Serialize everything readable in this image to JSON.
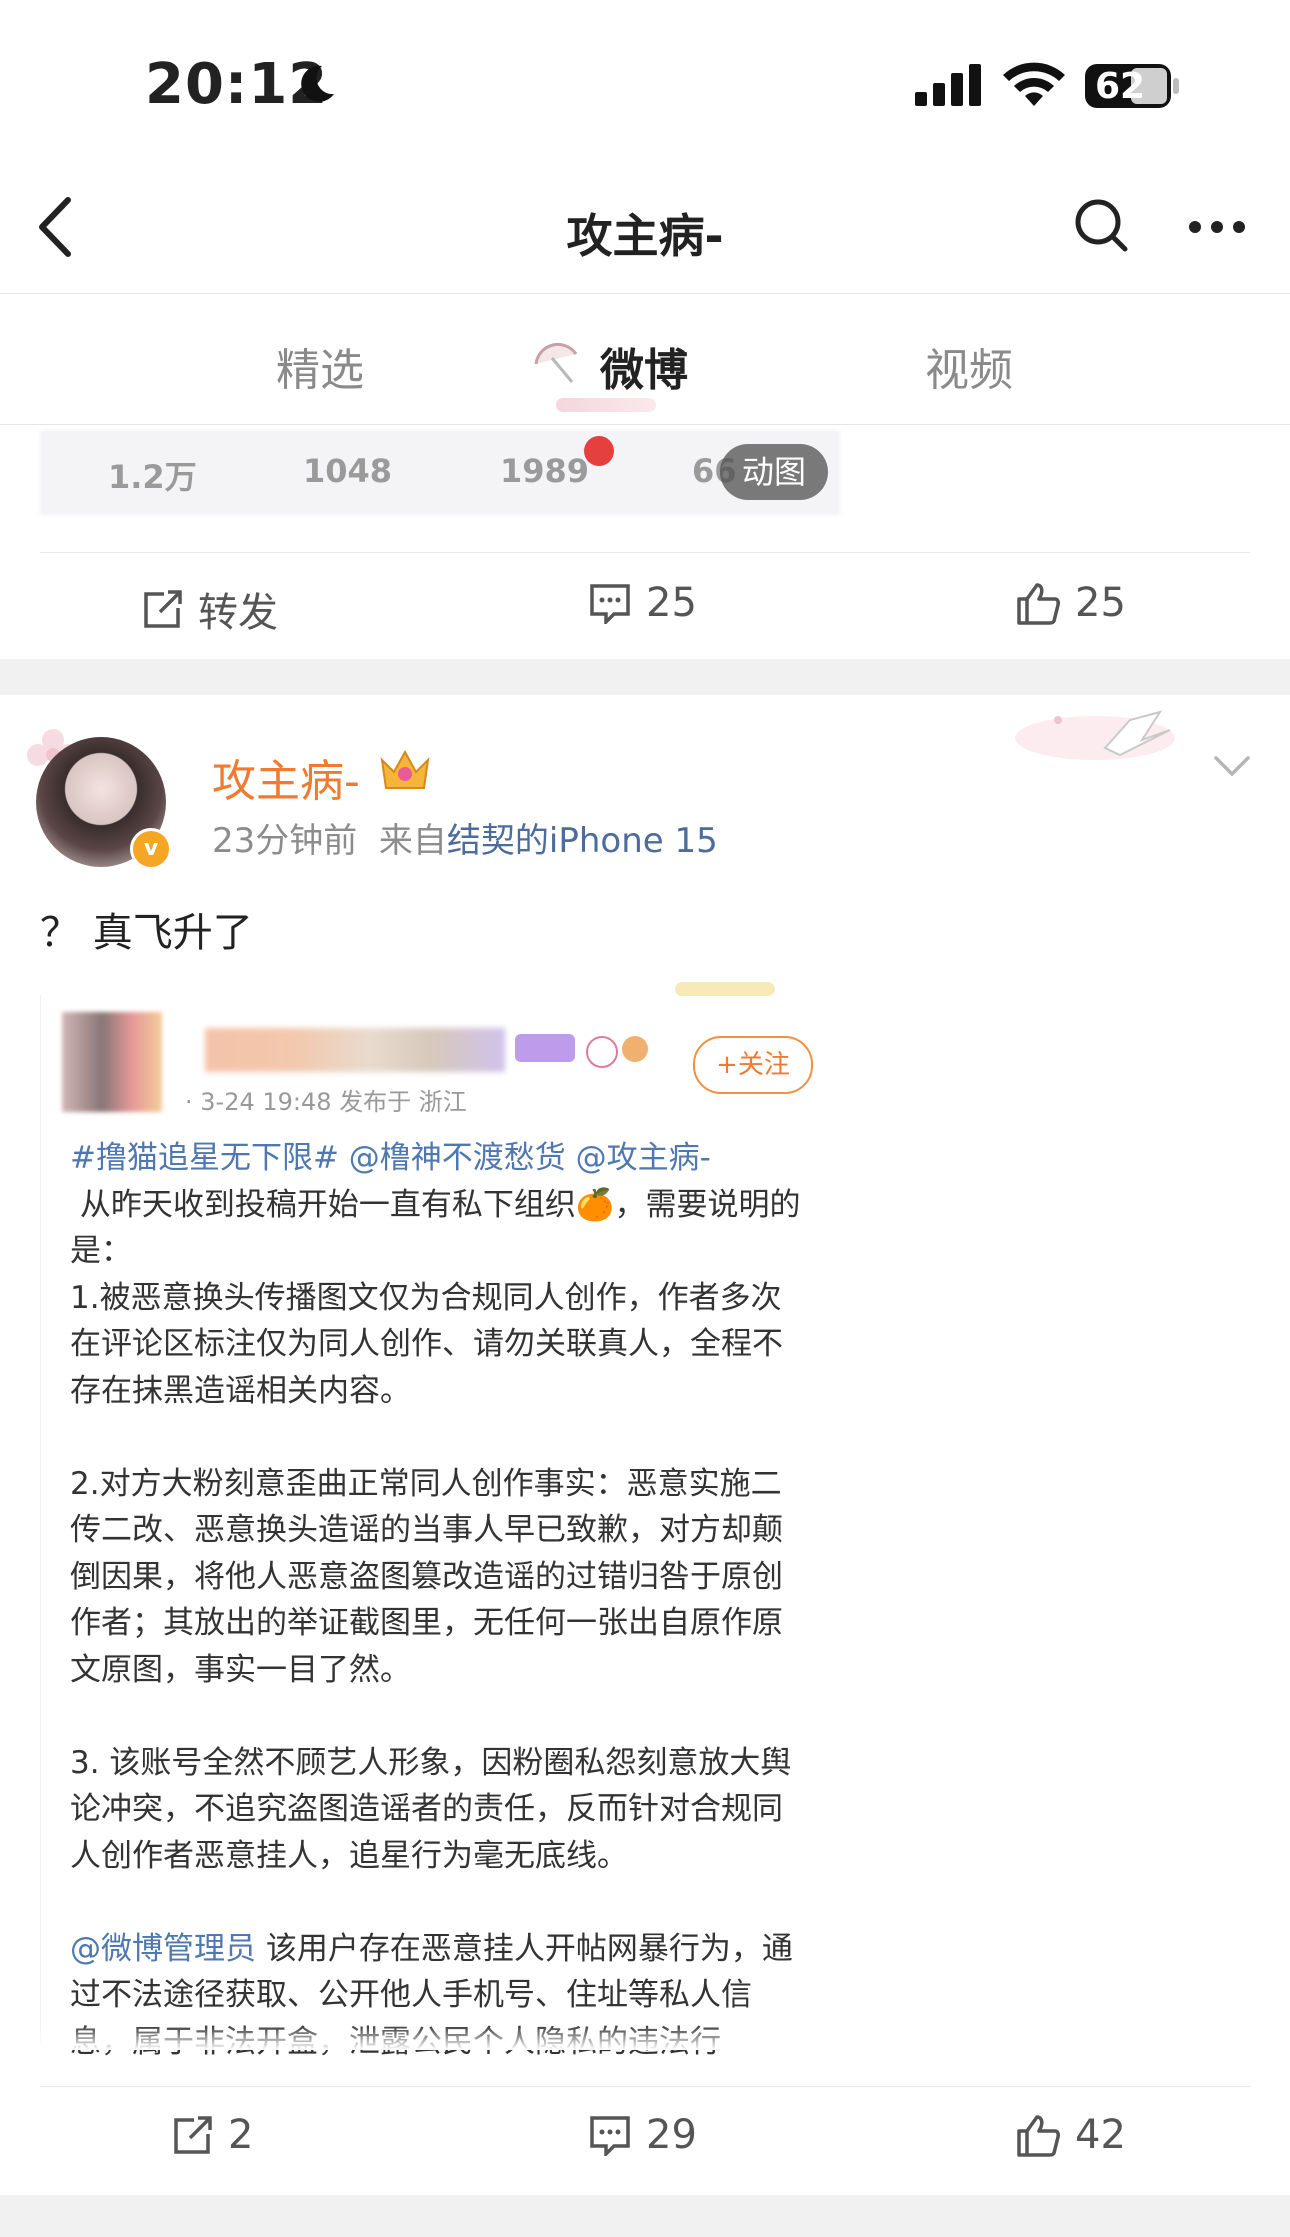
{
  "status_bar": {
    "time": "20:12",
    "battery": "62"
  },
  "nav": {
    "title": "攻主病-"
  },
  "tabs": [
    {
      "label": "精选"
    },
    {
      "label": "微博"
    },
    {
      "label": "视频"
    }
  ],
  "prev_post": {
    "stats": [
      "1.2万",
      "1048",
      "1989",
      "66"
    ],
    "gif_badge": "动图",
    "actions": {
      "repost": "转发",
      "comments": "25",
      "likes": "25"
    }
  },
  "post": {
    "author": "攻主病-",
    "time": "23分钟前",
    "source_prefix": "来自",
    "source": "结契的iPhone 15",
    "text": "？ 真飞升了",
    "quoted_screenshot": {
      "follow_label": "+关注",
      "meta": "· 3-24 19:48  发布于 浙江",
      "lines": [
        {
          "tag": "#撸猫追星无下限# @橹神不渡愁货 @攻主病-",
          "text": ""
        },
        {
          "tag": "",
          "text": " 从昨天收到投稿开始一直有私下组织🍊，需要说明的是："
        },
        {
          "tag": "",
          "text": "1.被恶意换头传播图文仅为合规同人创作，作者多次在评论区标注仅为同人创作、请勿关联真人，全程不存在抹黑造谣相关内容。"
        },
        {
          "tag": "",
          "text": " "
        },
        {
          "tag": "",
          "text": "2.对方大粉刻意歪曲正常同人创作事实：恶意实施二传二改、恶意换头造谣的当事人早已致歉，对方却颠倒因果，将他人恶意盗图篡改造谣的过错归咎于原创作者；其放出的举证截图里，无任何一张出自原作原文原图，事实一目了然。"
        },
        {
          "tag": "",
          "text": " "
        },
        {
          "tag": "",
          "text": "3. 该账号全然不顾艺人形象，因粉圈私怨刻意放大舆论冲突，不追究盗图造谣者的责任，反而针对合规同人创作者恶意挂人，追星行为毫无底线。"
        },
        {
          "tag": "",
          "text": " "
        },
        {
          "tag": "@微博管理员",
          "text": " 该用户存在恶意挂人开帖网暴行为，通过不法途径获取、公开他人手机号、住址等私人信息，属于非法开盒，泄露公民个人隐私的违法行"
        }
      ]
    },
    "actions": {
      "reposts": "2",
      "comments": "29",
      "likes": "42"
    }
  },
  "colors": {
    "accent": "#f07a2e",
    "link": "#4f77b0"
  }
}
